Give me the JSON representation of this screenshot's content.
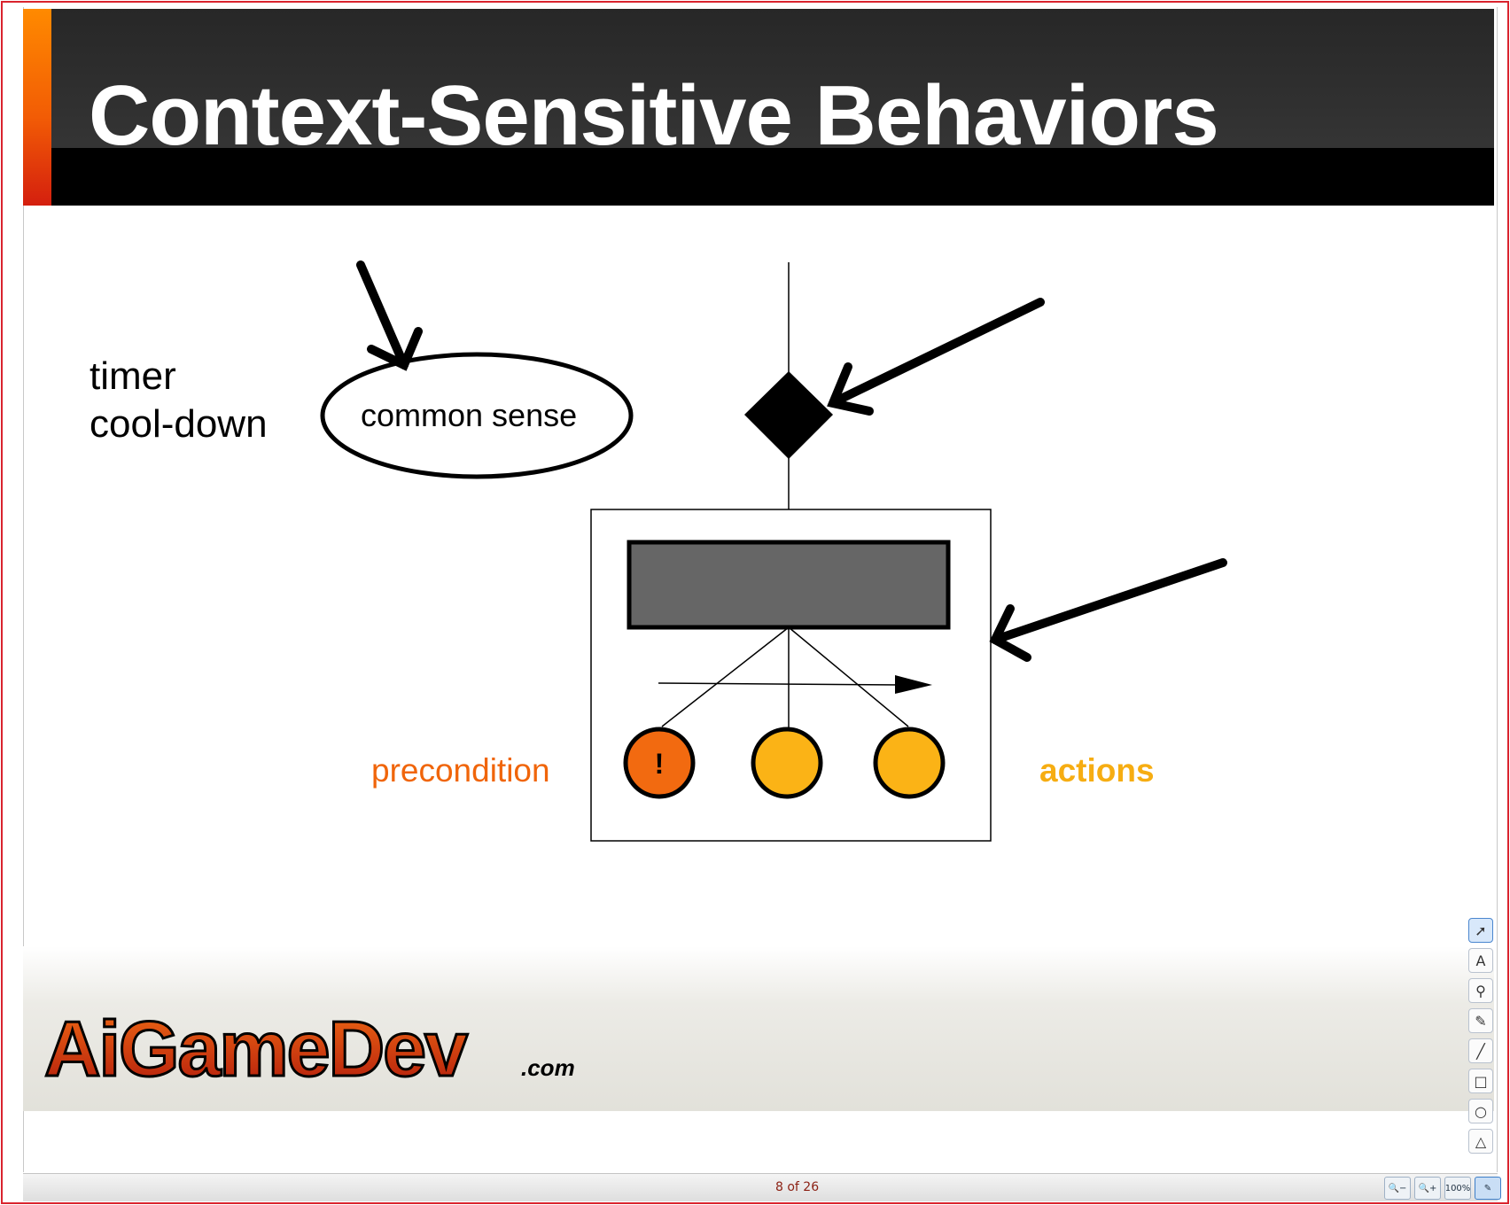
{
  "slide": {
    "title": "Context-Sensitive Behaviors",
    "labels": {
      "timer": "timer",
      "cooldown": "cool-down",
      "common_sense": "common sense",
      "precondition": "precondition",
      "actions": "actions",
      "exclamation": "!"
    },
    "colors": {
      "precondition": "#f0650a",
      "actions": "#f6ad12",
      "action_node_fill": "#fbb316",
      "precondition_node_fill": "#f26a10",
      "behavior_bar_fill": "#666666",
      "header_stripe_top": "#ff8a00",
      "header_stripe_bottom": "#d41f0e"
    },
    "logo": {
      "main": "AiGameDev",
      "suffix": ".com"
    }
  },
  "tools": [
    {
      "name": "select-tool",
      "icon": "pointer-icon",
      "glyph": "➚",
      "active": true
    },
    {
      "name": "text-tool",
      "icon": "text-a-icon",
      "glyph": "A",
      "active": false
    },
    {
      "name": "stamp-tool",
      "icon": "stamp-icon",
      "glyph": "⚲",
      "active": false
    },
    {
      "name": "highlighter-tool",
      "icon": "pencil-icon",
      "glyph": "✎",
      "active": false
    },
    {
      "name": "line-tool",
      "icon": "line-icon",
      "glyph": "╱",
      "active": false
    },
    {
      "name": "rectangle-tool",
      "icon": "square-icon",
      "glyph": "□",
      "active": false
    },
    {
      "name": "ellipse-tool",
      "icon": "circle-icon",
      "glyph": "○",
      "active": false
    },
    {
      "name": "triangle-tool",
      "icon": "triangle-icon",
      "glyph": "△",
      "active": false
    }
  ],
  "status": {
    "page_indicator": "8 of 26",
    "zoom_buttons": [
      {
        "name": "zoom-out-button",
        "icon": "zoom-out-icon",
        "glyph": "🔍−"
      },
      {
        "name": "zoom-in-button",
        "icon": "zoom-in-icon",
        "glyph": "🔍+"
      },
      {
        "name": "zoom-100-button",
        "icon": "zoom-100-icon",
        "glyph": "100%"
      },
      {
        "name": "annotate-button",
        "icon": "pen-icon",
        "glyph": "✎",
        "active": true
      }
    ]
  }
}
